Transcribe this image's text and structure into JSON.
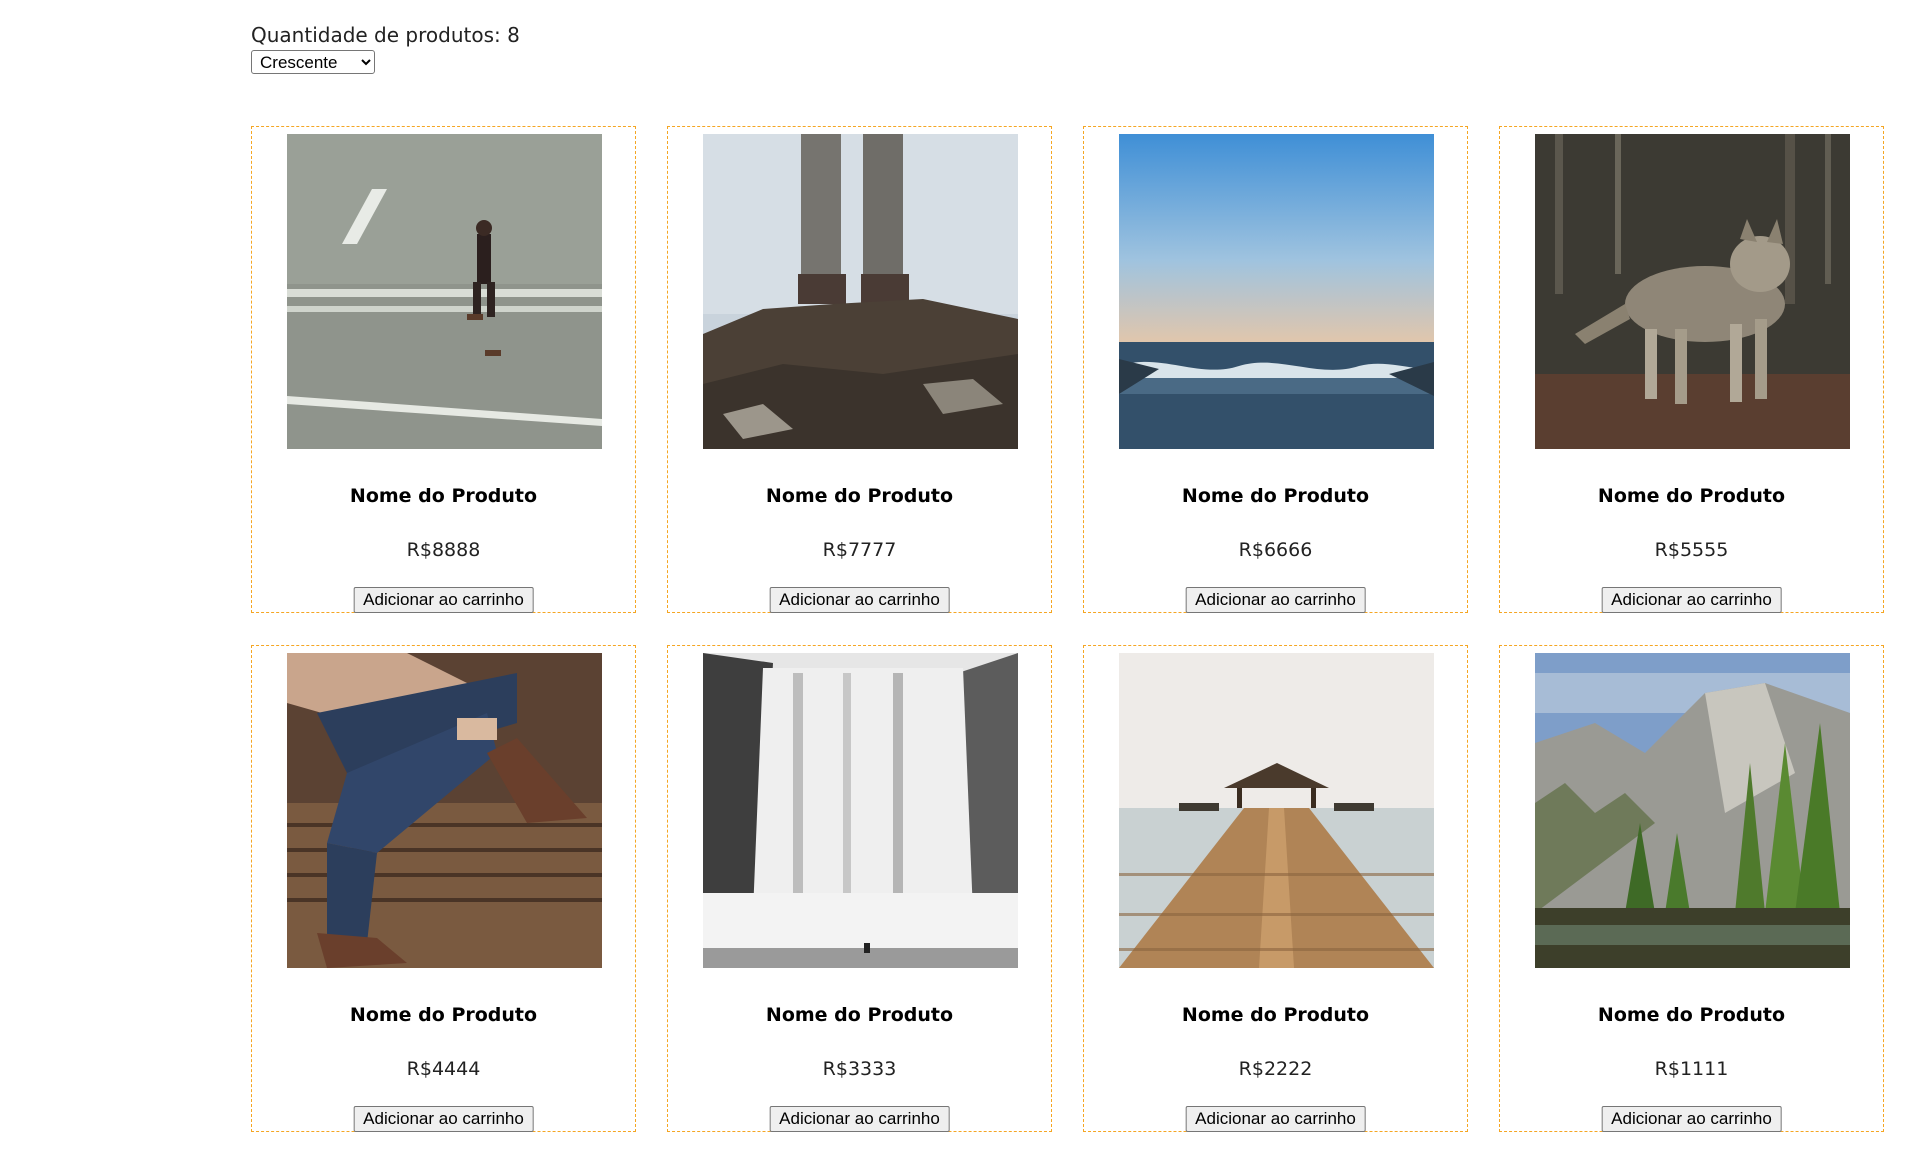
{
  "header": {
    "product_count_label": "Quantidade de produtos: 8",
    "sort": {
      "selected": "Crescente"
    }
  },
  "products": [
    {
      "name": "Nome do Produto",
      "price": "R$8888",
      "button_label": "Adicionar ao carrinho",
      "image": "man-walking-on-road"
    },
    {
      "name": "Nome do Produto",
      "price": "R$7777",
      "button_label": "Adicionar ao carrinho",
      "image": "legs-standing-on-cliff"
    },
    {
      "name": "Nome do Produto",
      "price": "R$6666",
      "button_label": "Adicionar ao carrinho",
      "image": "ocean-sunset-waves"
    },
    {
      "name": "Nome do Produto",
      "price": "R$5555",
      "button_label": "Adicionar ao carrinho",
      "image": "wolf-in-forest"
    },
    {
      "name": "Nome do Produto",
      "price": "R$4444",
      "button_label": "Adicionar ao carrinho",
      "image": "person-in-jeans-and-boots"
    },
    {
      "name": "Nome do Produto",
      "price": "R$3333",
      "button_label": "Adicionar ao carrinho",
      "image": "waterfall-black-and-white"
    },
    {
      "name": "Nome do Produto",
      "price": "R$2222",
      "button_label": "Adicionar ao carrinho",
      "image": "wooden-pier-gazebo"
    },
    {
      "name": "Nome do Produto",
      "price": "R$1111",
      "button_label": "Adicionar ao carrinho",
      "image": "mountain-valley-trees"
    }
  ],
  "colors": {
    "card_border": "#f5a623",
    "button_bg": "#efefef"
  }
}
